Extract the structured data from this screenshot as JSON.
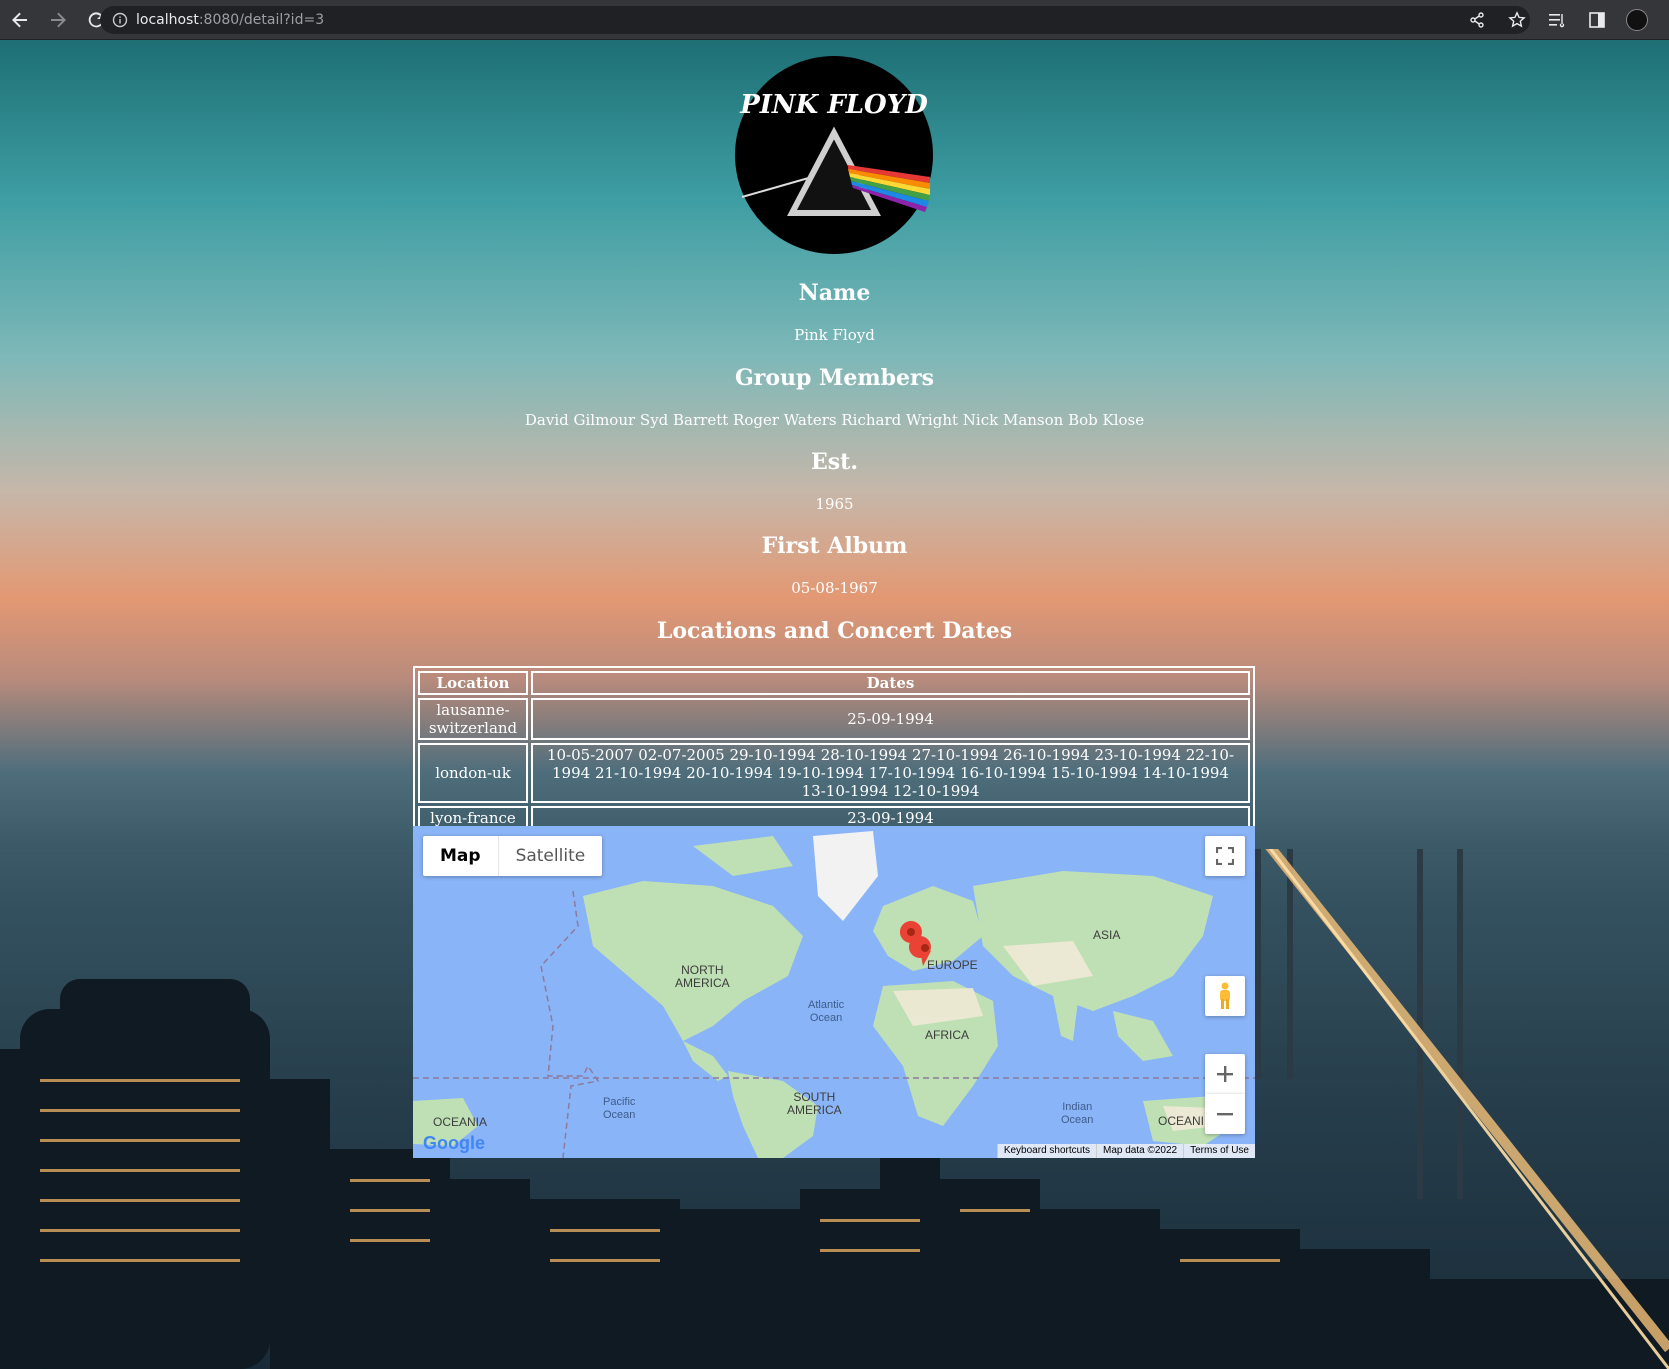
{
  "browser": {
    "url_host": "localhost",
    "url_path": ":8080/detail?id=3"
  },
  "artist": {
    "logo_text": "PINK FLOYD",
    "name_heading": "Name",
    "name": "Pink Floyd",
    "members_heading": "Group Members",
    "members": "David Gilmour Syd Barrett Roger Waters Richard Wright Nick Manson Bob Klose",
    "est_heading": "Est.",
    "est": "1965",
    "first_album_heading": "First Album",
    "first_album": "05-08-1967",
    "locations_heading": "Locations and Concert Dates"
  },
  "table": {
    "headers": [
      "Location",
      "Dates"
    ],
    "rows": [
      {
        "location": "lausanne-switzerland",
        "dates": "25-09-1994"
      },
      {
        "location": "london-uk",
        "dates": "10-05-2007 02-07-2005 29-10-1994 28-10-1994 27-10-1994 26-10-1994 23-10-1994 22-10-1994 21-10-1994 20-10-1994 19-10-1994 17-10-1994 16-10-1994 15-10-1994 14-10-1994 13-10-1994 12-10-1994"
      },
      {
        "location": "lyon-france",
        "dates": "23-09-1994"
      }
    ]
  },
  "map": {
    "type_map": "Map",
    "type_satellite": "Satellite",
    "labels": {
      "north_america": "NORTH\nAMERICA",
      "south_america": "SOUTH\nAMERICA",
      "europe": "EUROPE",
      "asia": "ASIA",
      "africa": "AFRICA",
      "oceania_left": "OCEANIA",
      "oceania_right": "OCEANI",
      "atlantic": "Atlantic\nOcean",
      "pacific": "Pacific\nOcean",
      "indian": "Indian\nOcean"
    },
    "footer": {
      "shortcuts": "Keyboard shortcuts",
      "data": "Map data ©2022",
      "terms": "Terms of Use"
    },
    "google_logo": "Google",
    "water_color": "#8ab4f8",
    "land_color": "#bfe0b4",
    "marker_color": "#ea4335"
  }
}
